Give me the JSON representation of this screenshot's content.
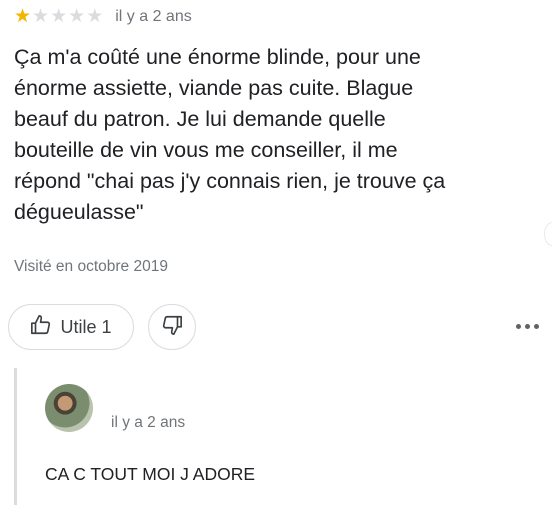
{
  "review": {
    "rating": 1,
    "rating_max": 5,
    "time": "il y a 2 ans",
    "text": "Ça m'a coûté une énorme blinde, pour une\nénorme assiette, viande pas cuite. Blague\nbeauf du patron. Je lui demande quelle\nbouteille de vin vous me conseiller, il me\nrépond \"chai pas j'y connais rien, je trouve ça\ndégueulasse\"",
    "visited": "Visité en octobre 2019"
  },
  "actions": {
    "helpful_label": "Utile 1",
    "helpful_icon": "thumbs-up-icon",
    "dislike_icon": "thumbs-down-icon",
    "more_icon": "more-horizontal-icon"
  },
  "reply": {
    "time": "il y a 2 ans",
    "text": "CA C TOUT MOI J ADORE"
  },
  "colors": {
    "star_on": "#f4b400",
    "star_off": "#dadce0",
    "text_secondary": "#70757a"
  }
}
